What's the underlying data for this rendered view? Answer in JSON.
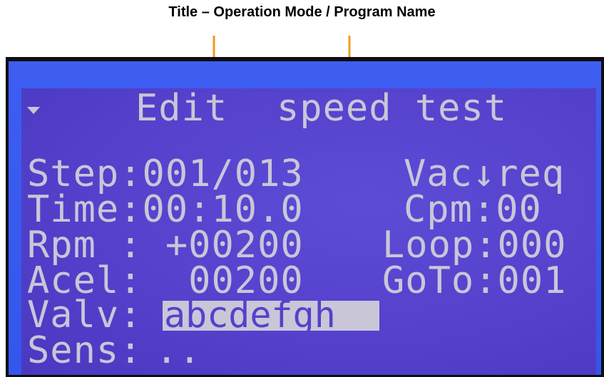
{
  "caption": "Title – Operation Mode / Program Name",
  "colors": {
    "arrow": "#f39a1e",
    "lcd_background": "#5441cc",
    "lcd_text": "#c9c6d8",
    "backlight_border": "#3e5ef2"
  },
  "display": {
    "header": {
      "menu_indicator_icon": "down-triangle-icon",
      "mode": "Edit",
      "program_name": "speed test"
    },
    "rows": [
      {
        "left": "Step:001/013",
        "right": "Vac↓req"
      },
      {
        "left": "Time:00:10.0",
        "right": "Cpm:00"
      },
      {
        "left": "Rpm : +00200",
        "right": "Loop:000"
      },
      {
        "left": "Acel:  00200",
        "right": "GoTo:001"
      }
    ],
    "valve": {
      "label": "Valv:",
      "value": "abcdefgh"
    },
    "sensor": {
      "label": "Sens:",
      "value": ".."
    }
  }
}
